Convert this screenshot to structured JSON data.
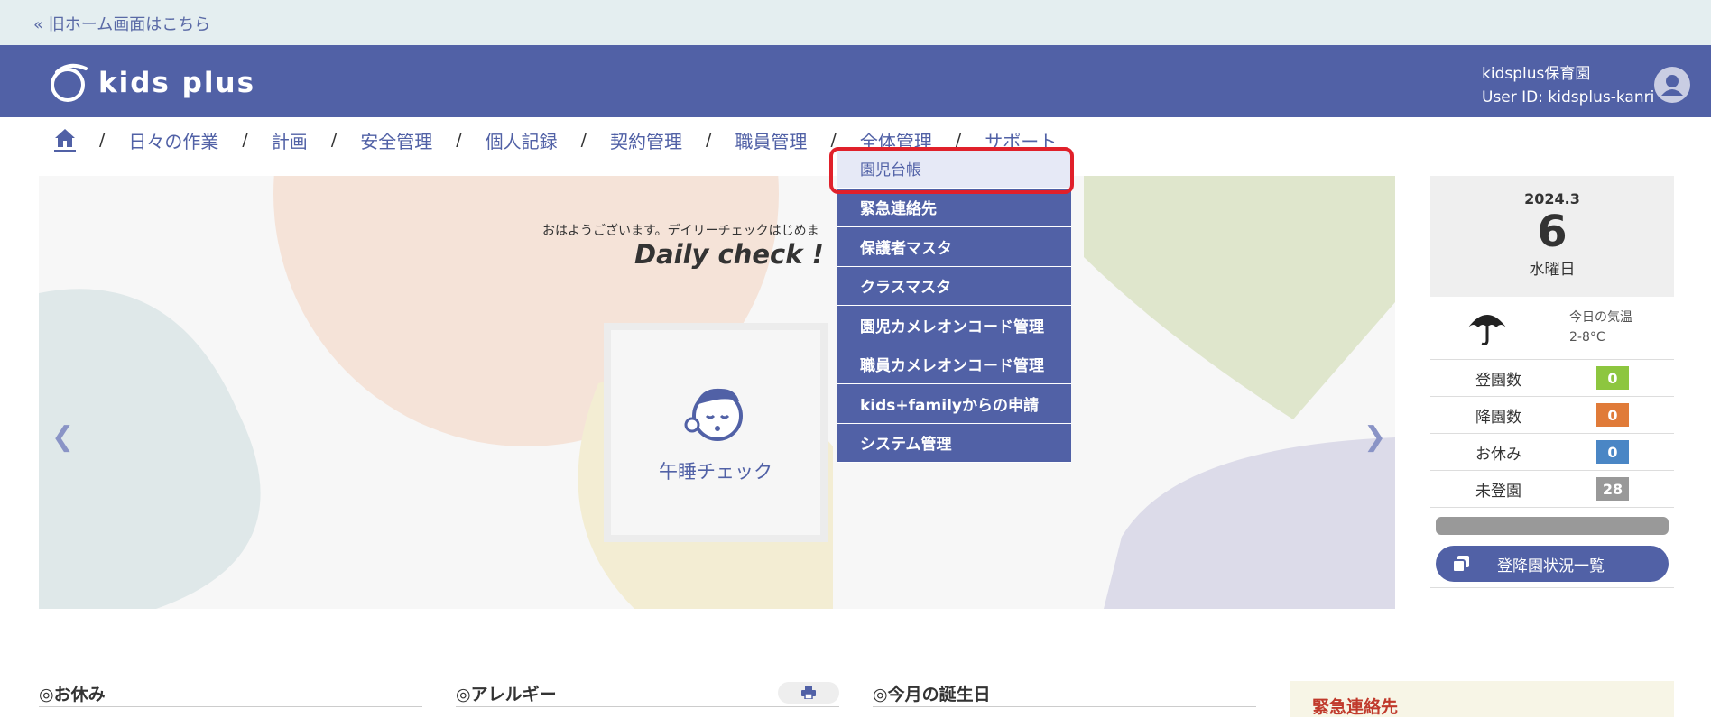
{
  "topbar": {
    "old_home_link": "« 旧ホーム画面はこちら"
  },
  "header": {
    "logo_text": "kids plus",
    "facility_name": "kidsplus保育園",
    "user_id": "User ID: kidsplus-kanri"
  },
  "nav": {
    "items": [
      "日々の作業",
      "計画",
      "安全管理",
      "個人記録",
      "契約管理",
      "職員管理",
      "全体管理",
      "サポート"
    ],
    "separator": "/"
  },
  "dropdown": {
    "items": [
      "園児台帳",
      "緊急連絡先",
      "保護者マスタ",
      "クラスマスタ",
      "園児カメレオンコード管理",
      "職員カメレオンコード管理",
      "kids+familyからの申請",
      "システム管理"
    ],
    "active_index": 0
  },
  "hero": {
    "greeting": "おはようございます。デイリーチェックはじめま",
    "daily_check": "Daily check !",
    "card_label": "午睡チェック"
  },
  "side": {
    "year_month": "2024.3",
    "day": "6",
    "weekday": "水曜日",
    "weather_icon": "umbrella-icon",
    "temp_label": "今日の気温",
    "temp_value": "2-8°C",
    "stats": [
      {
        "label": "登園数",
        "value": "0",
        "color": "#8dc63f"
      },
      {
        "label": "降園数",
        "value": "0",
        "color": "#e07b39"
      },
      {
        "label": "お休み",
        "value": "0",
        "color": "#4a86c5"
      },
      {
        "label": "未登園",
        "value": "28",
        "color": "#999999"
      }
    ],
    "status_button": "登降園状況一覧"
  },
  "sections": {
    "absence": "◎お休み",
    "allergy": "◎アレルギー",
    "birthday": "◎今月の誕生日",
    "emergency": "緊急連絡先"
  },
  "colors": {
    "primary": "#5161a6",
    "highlight": "#e0202a"
  }
}
